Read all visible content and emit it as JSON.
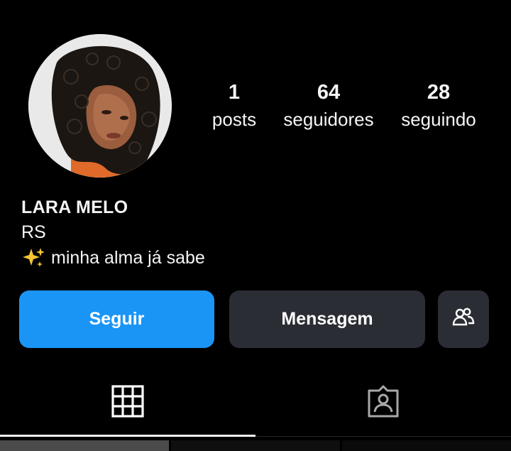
{
  "profile": {
    "name": "LARA MELO",
    "location": "RS",
    "bio_text": "minha alma já sabe",
    "bio_icon": "sparkle-icon",
    "avatar_icon": "profile-photo"
  },
  "stats": {
    "posts_count": "1",
    "posts_label": "posts",
    "followers_count": "64",
    "followers_label": "seguidores",
    "following_count": "28",
    "following_label": "seguindo"
  },
  "actions": {
    "follow_label": "Seguir",
    "message_label": "Mensagem",
    "suggest_icon": "add-people-icon"
  },
  "tabs": [
    {
      "icon": "grid-icon",
      "active": true
    },
    {
      "icon": "tagged-person-icon",
      "active": false
    }
  ],
  "colors": {
    "background": "#000000",
    "primary_button": "#1b95f5",
    "secondary_button": "#2a2d33",
    "text": "#f5f5f5"
  }
}
